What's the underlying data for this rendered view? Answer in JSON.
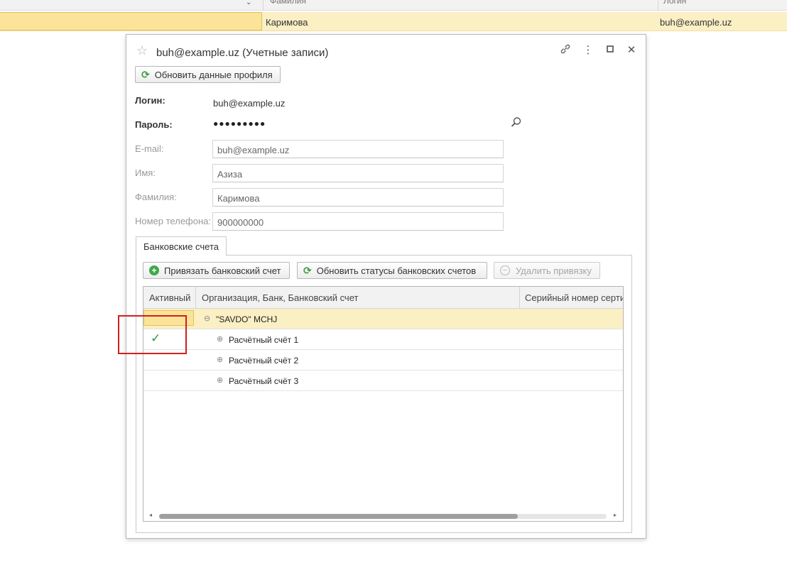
{
  "background": {
    "columns": [
      "Фамилия",
      "Логин"
    ],
    "row": {
      "surname": "Каримова",
      "login": "buh@example.uz"
    }
  },
  "window": {
    "title": "buh@example.uz (Учетные записи)",
    "refresh_button": "Обновить данные профиля",
    "login_label": "Логин:",
    "login_value": "buh@example.uz",
    "password_label": "Пароль:",
    "password_value": "●●●●●●●●●",
    "email_label": "E-mail:",
    "email_value": "buh@example.uz",
    "name_label": "Имя:",
    "name_value": "Азиза",
    "surname_label": "Фамилия:",
    "surname_value": "Каримова",
    "phone_label": "Номер телефона:",
    "phone_value": "900000000"
  },
  "tabs": [
    {
      "label": "Банковские счета",
      "active": true
    }
  ],
  "toolbar": {
    "bind_label": "Привязать банковский счет",
    "update_label": "Обновить статусы банковских счетов",
    "delete_label": "Удалить привязку"
  },
  "grid": {
    "columns": [
      "Активный",
      "Организация, Банк, Банковский счет",
      "Серийный номер серти"
    ],
    "rows": [
      {
        "active": false,
        "name": "\"SAVDO\" MCHJ",
        "level": 0,
        "toggle": "⊖"
      },
      {
        "active": true,
        "name": "Расчётный счёт 1",
        "level": 1,
        "toggle": "⊕"
      },
      {
        "active": false,
        "name": "Расчётный счёт 2",
        "level": 1,
        "toggle": "⊕"
      },
      {
        "active": false,
        "name": "Расчётный счёт 3",
        "level": 1,
        "toggle": "⊕"
      }
    ]
  },
  "icons": {
    "star": "☆",
    "link": "🔗",
    "menu": "⋮",
    "maximize": "☐",
    "close": "✕",
    "refresh": "⟳",
    "plus": "+",
    "minus": "−",
    "check": "✓",
    "magnify": "🔍"
  },
  "colors": {
    "selection": "#fbefc4",
    "selected_cell": "#fbe39a",
    "check_green": "#2f9a3f",
    "highlight_red": "#d01f1f"
  }
}
